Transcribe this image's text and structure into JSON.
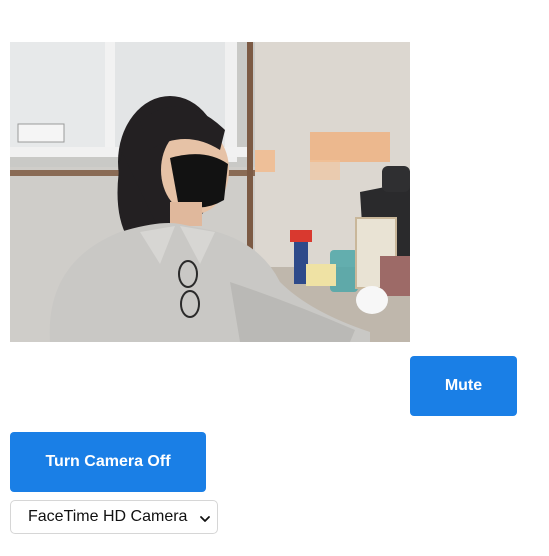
{
  "controls": {
    "mute_label": "Mute",
    "camera_toggle_label": "Turn Camera Off",
    "camera_select": {
      "selected": "FaceTime HD Camera"
    }
  },
  "icons": {
    "select_arrow": "chevron-down-icon"
  },
  "colors": {
    "button_bg": "#1a7fe6",
    "button_text": "#ffffff"
  }
}
